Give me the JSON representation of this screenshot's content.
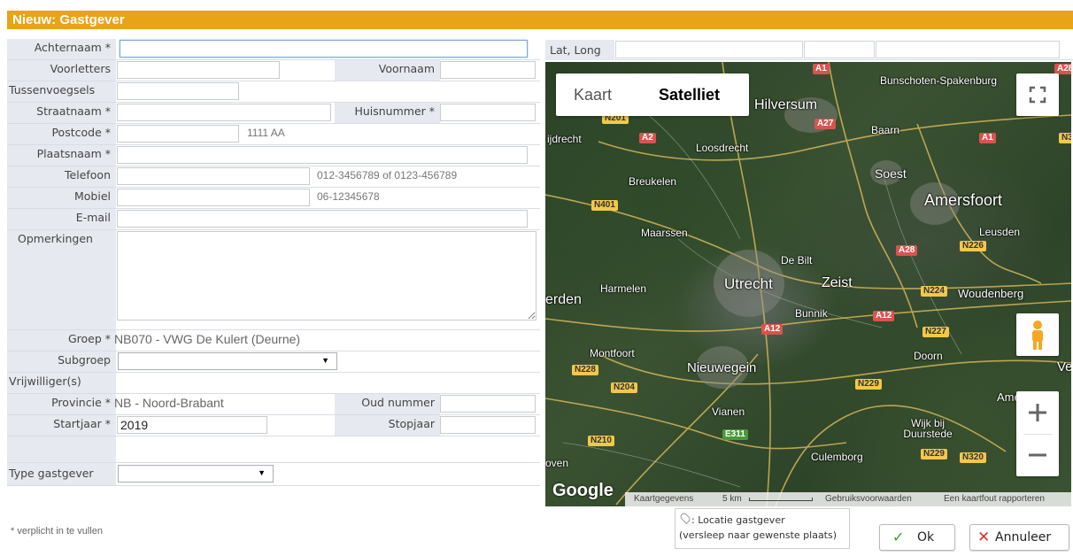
{
  "dialog": {
    "title": "Nieuw: Gastgever"
  },
  "form": {
    "achternaam": {
      "label": "Achternaam *",
      "value": ""
    },
    "voorletters": {
      "label": "Voorletters",
      "value": ""
    },
    "voornaam": {
      "label": "Voornaam",
      "value": ""
    },
    "tussenvoegsels": {
      "label": "Tussenvoegsels",
      "value": ""
    },
    "straatnaam": {
      "label": "Straatnaam *",
      "value": ""
    },
    "huisnummer": {
      "label": "Huisnummer *",
      "value": ""
    },
    "postcode": {
      "label": "Postcode *",
      "value": "",
      "hint": "1111 AA"
    },
    "plaatsnaam": {
      "label": "Plaatsnaam *",
      "value": ""
    },
    "telefoon": {
      "label": "Telefoon",
      "value": "",
      "hint": "012-3456789 of 0123-456789"
    },
    "mobiel": {
      "label": "Mobiel",
      "value": "",
      "hint": "06-12345678"
    },
    "email": {
      "label": "E-mail",
      "value": ""
    },
    "opmerkingen": {
      "label": "Opmerkingen",
      "value": ""
    },
    "groep": {
      "label": "Groep *",
      "value": "NB070 - VWG De Kulert (Deurne)"
    },
    "subgroep": {
      "label": "Subgroep",
      "value": ""
    },
    "vrijwilligers": {
      "label": "Vrijwilliger(s)",
      "value": ""
    },
    "provincie": {
      "label": "Provincie *",
      "value": "NB - Noord-Brabant"
    },
    "oud_nummer": {
      "label": "Oud nummer",
      "value": ""
    },
    "startjaar": {
      "label": "Startjaar *",
      "value": "2019"
    },
    "stopjaar": {
      "label": "Stopjaar",
      "value": ""
    },
    "type_gastgever": {
      "label": "Type gastgever",
      "value": ""
    },
    "footnote": "* verplicht in te vullen"
  },
  "map": {
    "coord_label": "Lat, Long",
    "map_types": [
      "Kaart",
      "Satelliet"
    ],
    "active_type": "Satelliet",
    "places": [
      "Bunschoten-Spakenburg",
      "Hilversum",
      "Baarn",
      "ijdrecht",
      "Loosdrecht",
      "Soest",
      "Breukelen",
      "Amersfoort",
      "Maarssen",
      "Leusden",
      "De Bilt",
      "Harmelen",
      "Utrecht",
      "Zeist",
      "erden",
      "Woudenberg",
      "Bunnik",
      "Montfoort",
      "Doorn",
      "Nieuwegein",
      "Ve",
      "Amer",
      "Vianen",
      "Wijk bij Duurstede",
      "Culemborg",
      "oven"
    ],
    "roads": [
      "A1",
      "A28",
      "N201",
      "A27",
      "A1",
      "N3",
      "A2",
      "N401",
      "A28",
      "N226",
      "N224",
      "A12",
      "N227",
      "A12",
      "N228",
      "N204",
      "N229",
      "E311",
      "N210",
      "N229",
      "N320"
    ],
    "attribution": {
      "data": "Kaartgegevens",
      "scale": "5 km",
      "terms": "Gebruiksvoorwaarden",
      "report": "Een kaartfout rapporteren"
    },
    "logo": "Google"
  },
  "legend": {
    "line1": ": Locatie gastgever",
    "line2": "(versleep naar gewenste plaats)"
  },
  "buttons": {
    "ok": "Ok",
    "cancel": "Annuleer"
  },
  "colors": {
    "title_bar": "#e8a317",
    "label_bg": "#e6e9ef",
    "cancel_x": "#d9342b",
    "ok_check": "#3a9a2b"
  }
}
